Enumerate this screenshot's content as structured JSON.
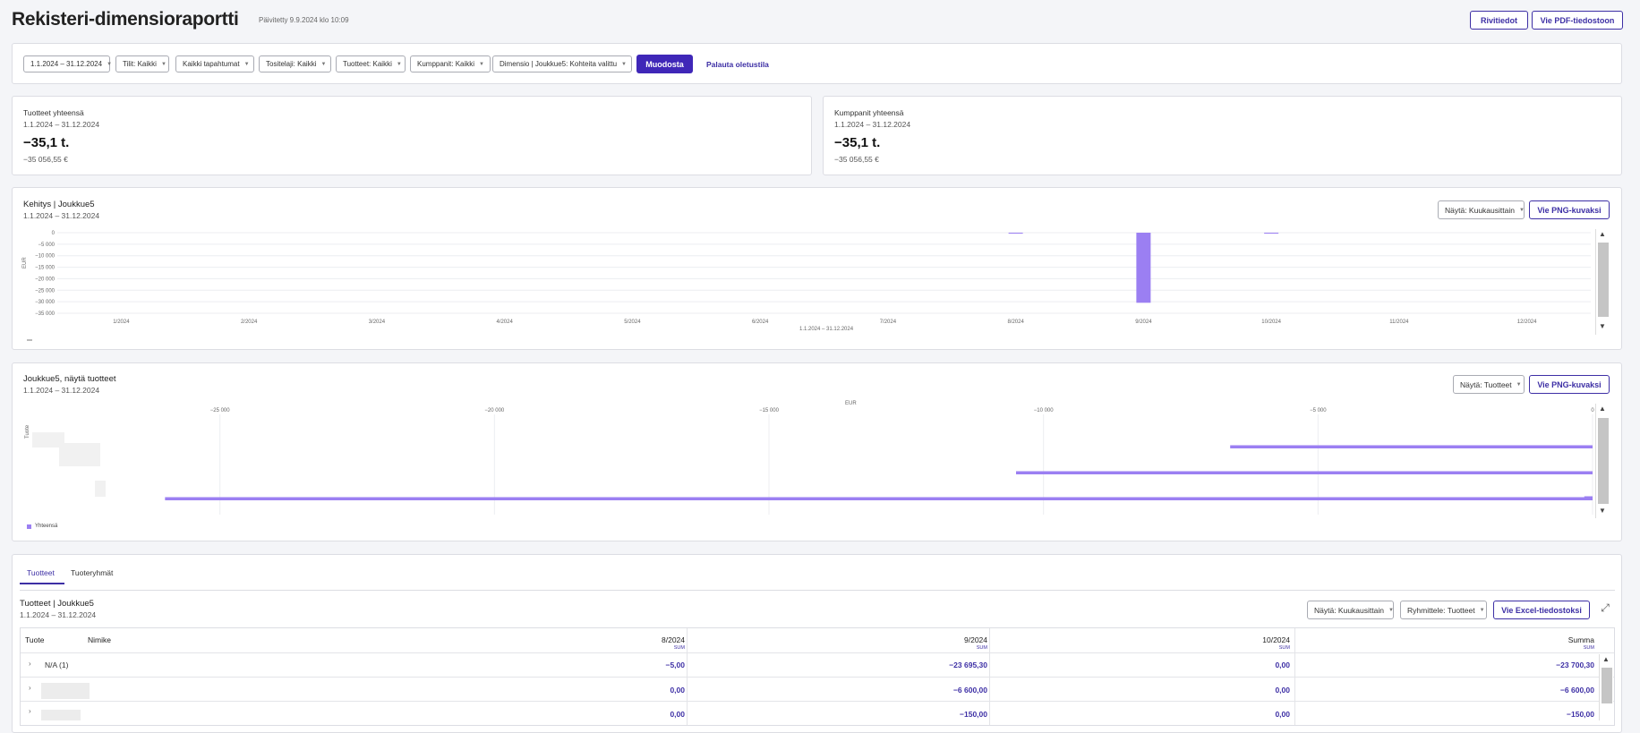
{
  "header": {
    "title": "Rekisteri-dimensioraportti",
    "updated": "Päivitetty 9.9.2024 klo 10:09",
    "row_details_button": "Rivitiedot",
    "export_pdf_button": "Vie PDF-tiedostoon"
  },
  "filters": {
    "date_range": "1.1.2024 – 31.12.2024",
    "accounts": "Tilit: Kaikki",
    "events": "Kaikki tapahtumat",
    "voucher_type": "Tositelaji: Kaikki",
    "products": "Tuotteet: Kaikki",
    "partners": "Kumppanit: Kaikki",
    "dimension": "Dimensio | Joukkue5: Kohteita valittu",
    "generate_button": "Muodosta",
    "reset_link": "Palauta oletustila"
  },
  "summary_products": {
    "title": "Tuotteet yhteensä",
    "period": "1.1.2024 – 31.12.2024",
    "value": "−35,1 t.",
    "sub_value": "−35 056,55 €"
  },
  "summary_partners": {
    "title": "Kumppanit yhteensä",
    "period": "1.1.2024 – 31.12.2024",
    "value": "−35,1 t.",
    "sub_value": "−35 056,55 €"
  },
  "trend_chart": {
    "title": "Kehitys | Joukkue5",
    "period": "1.1.2024 – 31.12.2024",
    "view_select": "Näytä: Kuukausittain",
    "export_png": "Vie PNG-kuvaksi",
    "ylabel": "EUR",
    "xlabel": "1.1.2024 – 31.12.2024",
    "y_ticks": [
      "0",
      "−5 000",
      "−10 000",
      "−15 000",
      "−20 000",
      "−25 000",
      "−30 000",
      "−35 000"
    ]
  },
  "products_chart": {
    "title": "Joukkue5, näytä tuotteet",
    "period": "1.1.2024 – 31.12.2024",
    "view_select": "Näytä: Tuotteet",
    "export_png": "Vie PNG-kuvaksi",
    "xlabel": "EUR",
    "ylabel": "Tuote",
    "x_ticks": [
      "−25 000",
      "−20 000",
      "−15 000",
      "−10 000",
      "−5 000",
      "0"
    ],
    "legend": "Yhteensä"
  },
  "chart_data": [
    {
      "type": "bar",
      "title": "Kehitys | Joukkue5",
      "xlabel": "1.1.2024 – 31.12.2024",
      "ylabel": "EUR",
      "categories": [
        "1/2024",
        "2/2024",
        "3/2024",
        "4/2024",
        "5/2024",
        "6/2024",
        "7/2024",
        "8/2024",
        "9/2024",
        "10/2024",
        "11/2024",
        "12/2024"
      ],
      "values": [
        0,
        0,
        0,
        0,
        0,
        0,
        0,
        -5.0,
        -30445.3,
        -150.0,
        0,
        0
      ],
      "ylim": [
        -35000,
        0
      ],
      "grid": true,
      "color": "#9b7ff2"
    },
    {
      "type": "bar",
      "orientation": "horizontal",
      "title": "Joukkue5, näytä tuotteet",
      "xlabel": "EUR",
      "ylabel": "Tuote",
      "series": [
        {
          "name": "Yhteensä",
          "values": [
            -6600,
            -10500,
            -26000,
            -150
          ]
        }
      ],
      "xlim": [
        -27000,
        0
      ],
      "grid": true,
      "color": "#9b7ff2"
    }
  ],
  "table_section": {
    "tab_products": "Tuotteet",
    "tab_groups": "Tuoteryhmät",
    "title": "Tuotteet | Joukkue5",
    "period": "1.1.2024 – 31.12.2024",
    "view_select": "Näytä: Kuukausittain",
    "group_select": "Ryhmittele: Tuotteet",
    "export_excel": "Vie Excel-tiedostoksi",
    "columns": {
      "product": "Tuote",
      "name": "Nimike",
      "aug": "8/2024",
      "sep": "9/2024",
      "oct": "10/2024",
      "total": "Summa",
      "sum_label": "SUM"
    },
    "rows": [
      {
        "name": "N/A (1)",
        "aug": "−5,00",
        "sep": "−23 695,30",
        "oct": "0,00",
        "total": "−23 700,30"
      },
      {
        "name": "",
        "aug": "0,00",
        "sep": "−6 600,00",
        "oct": "0,00",
        "total": "−6 600,00"
      },
      {
        "name": "",
        "aug": "0,00",
        "sep": "−150,00",
        "oct": "0,00",
        "total": "−150,00"
      }
    ]
  }
}
